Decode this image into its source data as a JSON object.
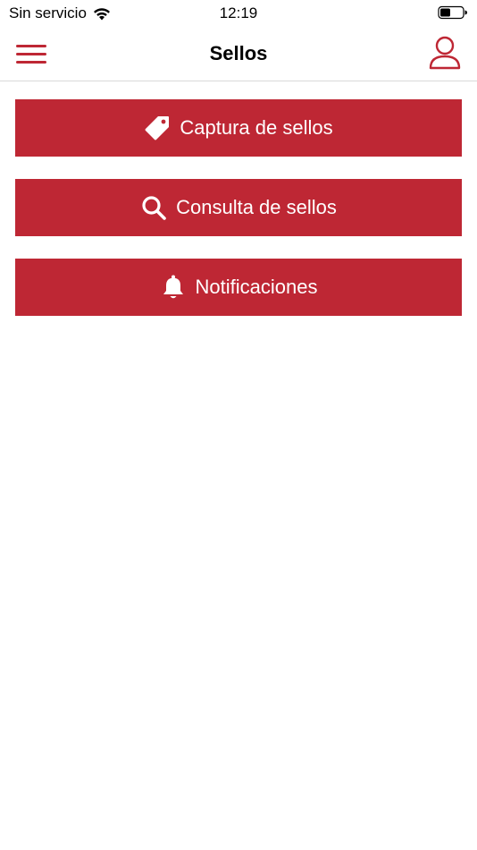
{
  "status_bar": {
    "carrier": "Sin servicio",
    "time": "12:19",
    "wifi_icon": "wifi-icon",
    "battery_icon": "battery-icon"
  },
  "nav": {
    "title": "Sellos",
    "menu_icon": "hamburger-menu-icon",
    "profile_icon": "user-profile-icon"
  },
  "actions": [
    {
      "label": "Captura de sellos",
      "icon": "tag-icon"
    },
    {
      "label": "Consulta de sellos",
      "icon": "search-icon"
    },
    {
      "label": "Notificaciones",
      "icon": "bell-icon"
    }
  ],
  "colors": {
    "accent": "#be2734",
    "button_text": "#ffffff"
  }
}
